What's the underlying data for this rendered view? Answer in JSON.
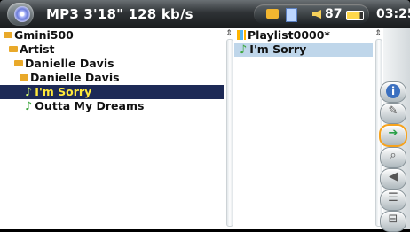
{
  "header": {
    "title": "MP3 3'18\" 128 kb/s",
    "volume": "87",
    "time": "03:25"
  },
  "browser": {
    "items": [
      {
        "label": "Gmini500",
        "type": "folder",
        "indent": 0
      },
      {
        "label": "Artist",
        "type": "folder",
        "indent": 1
      },
      {
        "label": "Danielle Davis",
        "type": "folder",
        "indent": 2
      },
      {
        "label": "Danielle Davis",
        "type": "folder",
        "indent": 3
      },
      {
        "label": "I'm Sorry",
        "type": "track",
        "indent": 4,
        "selected": true
      },
      {
        "label": "Outta My Dreams",
        "type": "track",
        "indent": 4
      }
    ]
  },
  "playlist": {
    "title": "Playlist0000*",
    "items": [
      {
        "label": "I'm Sorry",
        "highlighted": true
      }
    ]
  },
  "side_buttons": [
    "info-icon",
    "edit-icon",
    "move-icon",
    "search-icon",
    "volume-icon",
    "save-icon",
    "close-icon"
  ],
  "colors": {
    "selection_bg": "#1d2a56",
    "selection_text": "#ffe93a",
    "highlight_bg": "#bfd6ea",
    "active_border": "#f6a21c"
  }
}
